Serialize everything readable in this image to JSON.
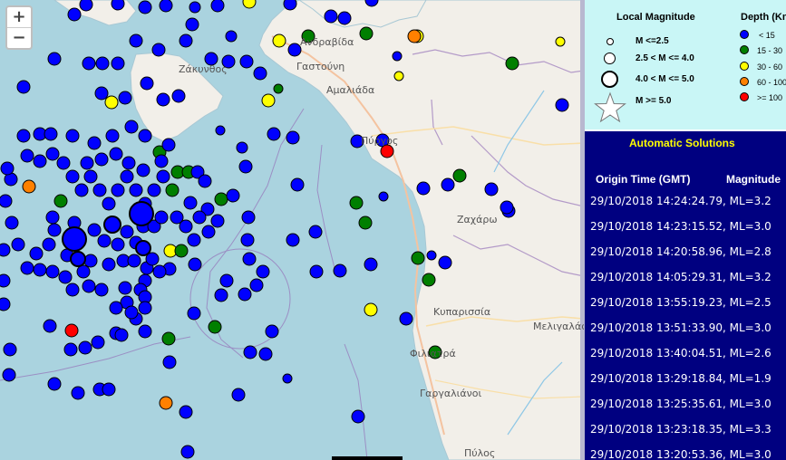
{
  "map": {
    "zoom_in": "+",
    "zoom_out": "−",
    "places": [
      {
        "name": "Ανδραβίδα"
      },
      {
        "name": "Γαστούνη"
      },
      {
        "name": "Αμαλιάδα"
      },
      {
        "name": "Ζάκυνθος"
      },
      {
        "name": "Πύργος"
      },
      {
        "name": "Ζαχάρω"
      },
      {
        "name": "Κυπαρισσία"
      },
      {
        "name": "Μελιγαλάς"
      },
      {
        "name": "Φιλιατρά"
      },
      {
        "name": "Γαργαλιάνοι"
      },
      {
        "name": "Πύλος"
      }
    ]
  },
  "legend": {
    "magnitude_title": "Local Magnitude",
    "magnitude_items": [
      "M <=2.5",
      "2.5 < M <= 4.0",
      "4.0 < M <= 5.0",
      "M >= 5.0"
    ],
    "depth_title": "Depth (Km)",
    "depth_items": [
      {
        "label": "< 15",
        "color": "#0000ff"
      },
      {
        "label": "15 - 30",
        "color": "#007f00"
      },
      {
        "label": "30 - 60",
        "color": "#ffff00"
      },
      {
        "label": "60 - 100",
        "color": "#ff8000"
      },
      {
        "label": ">= 100",
        "color": "#ff0000"
      }
    ]
  },
  "solutions": {
    "title": "Automatic Solutions",
    "header_time": "Origin Time (GMT)",
    "header_mag": "Magnitude",
    "rows": [
      "29/10/2018 14:24:24.79, ML=3.2",
      "29/10/2018 14:23:15.52, ML=3.0",
      "29/10/2018 14:20:58.96, ML=2.8",
      "29/10/2018 14:05:29.31, ML=3.2",
      "29/10/2018 13:55:19.23, ML=2.5",
      "29/10/2018 13:51:33.90, ML=3.0",
      "29/10/2018 13:40:04.51, ML=2.6",
      "29/10/2018 13:29:18.84, ML=1.9",
      "29/10/2018 13:25:35.61, ML=3.0",
      "29/10/2018 13:23:18.35, ML=3.3",
      "29/10/2018 13:20:53.36, ML=3.0"
    ]
  },
  "colors": {
    "sea": "#aad3df",
    "land": "#f2efe9",
    "panel_bg": "#000080",
    "legend_bg": "#c9f6f6",
    "panel_title": "#ffff00",
    "depth_shallow": "#0000ff",
    "depth_15_30": "#007f00",
    "depth_30_60": "#ffff00",
    "depth_60_100": "#ff8000",
    "depth_deep": "#ff0000"
  }
}
